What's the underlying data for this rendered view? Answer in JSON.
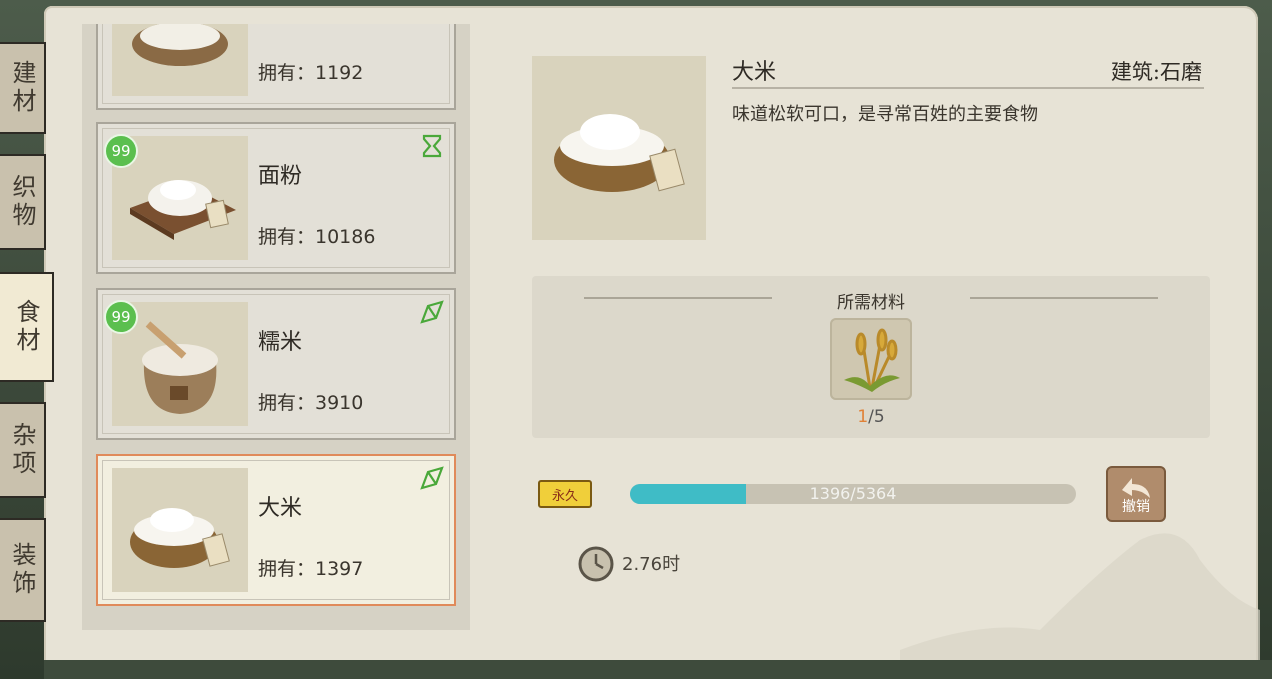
{
  "side_tabs": [
    {
      "label": "建材",
      "active": false
    },
    {
      "label": "织物",
      "active": false
    },
    {
      "label": "食材",
      "active": true
    },
    {
      "label": "杂项",
      "active": false
    },
    {
      "label": "装饰",
      "active": false
    }
  ],
  "items": [
    {
      "name": "",
      "owned": "拥有：1192",
      "badge": "",
      "corner_icon": "",
      "selected": false
    },
    {
      "name": "面粉",
      "owned": "拥有：10186",
      "badge": "99",
      "corner_icon": "hourglass-icon",
      "selected": false
    },
    {
      "name": "糯米",
      "owned": "拥有：3910",
      "badge": "99",
      "corner_icon": "ribbon-icon",
      "selected": false
    },
    {
      "name": "大米",
      "owned": "拥有：1397",
      "badge": "",
      "corner_icon": "ribbon-icon",
      "selected": true
    }
  ],
  "detail": {
    "name": "大米",
    "building": "建筑:石磨",
    "description": "味道松软可口，是寻常百姓的主要食物",
    "materials_title": "所需材料",
    "material": {
      "icon": "wheat-icon",
      "have": "1",
      "need": "/5"
    },
    "permanent_badge": "永久",
    "progress_text": "1396/5364",
    "progress_fraction": 0.2603,
    "undo_label": "撤销",
    "time": "2.76时"
  },
  "colors": {
    "paper": "#e7e3d6",
    "progress_fill": "#3fbcc6",
    "badge_green": "#5bbf4e",
    "selected_border": "#e08a5a"
  }
}
